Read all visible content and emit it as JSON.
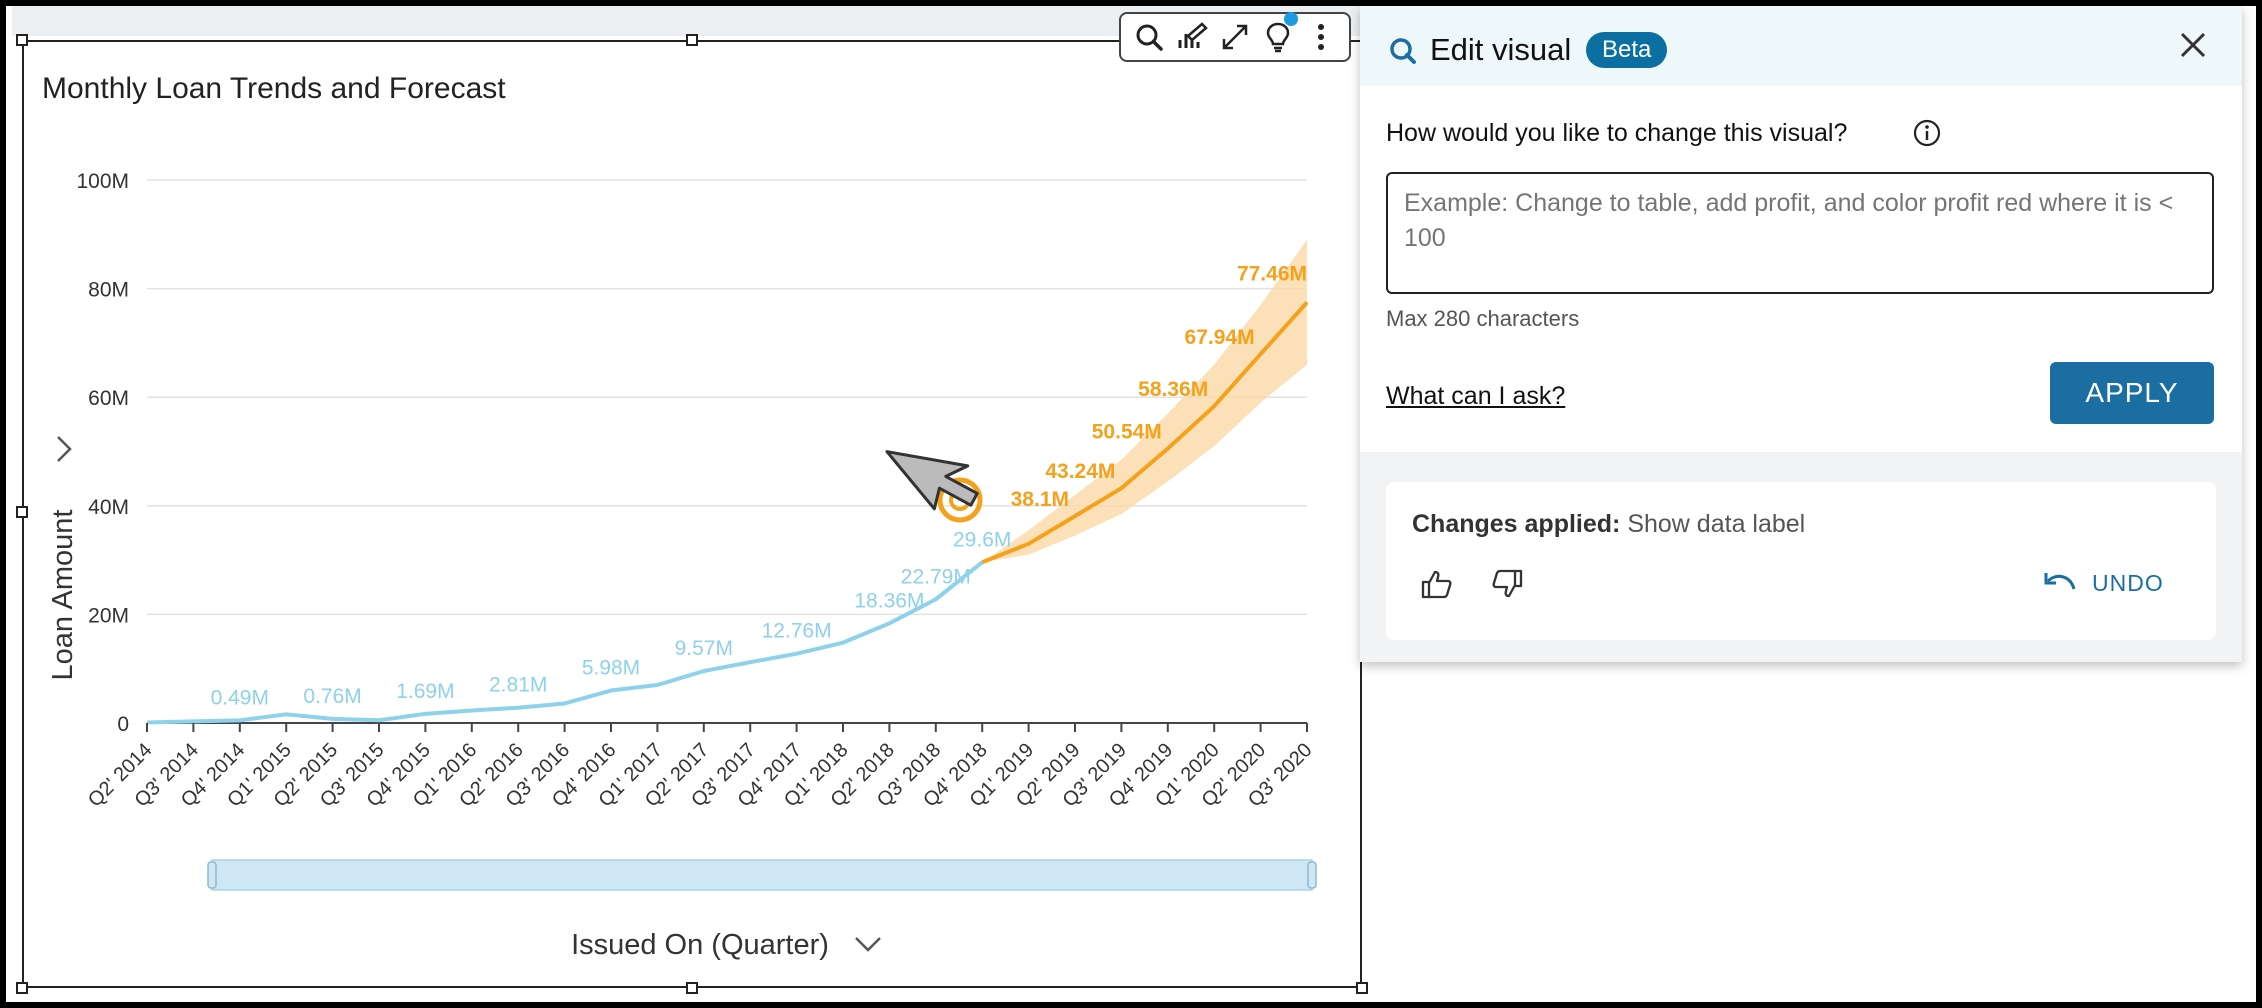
{
  "visual": {
    "title": "Monthly Loan Trends and Forecast"
  },
  "toolbar": {
    "icons": [
      "search-icon",
      "chart-edit-icon",
      "expand-icon",
      "insight-bulb-icon",
      "more-options-icon"
    ]
  },
  "colors": {
    "actual": "#8ed1ea",
    "forecast": "#f5a11c",
    "band": "#fbd9a6",
    "accent": "#1a6ea2",
    "beta_badge": "#0b6fa1"
  },
  "chart_data": {
    "type": "line",
    "title": "Monthly Loan Trends and Forecast",
    "xlabel": "Issued On (Quarter)",
    "ylabel": "Loan Amount",
    "ylim": [
      0,
      100000000
    ],
    "yticks": [
      "100M",
      "80M",
      "60M",
      "40M",
      "20M",
      "0"
    ],
    "grid": true,
    "categories": [
      "Q2' 2014",
      "Q3' 2014",
      "Q4' 2014",
      "Q1' 2015",
      "Q2' 2015",
      "Q3' 2015",
      "Q4' 2015",
      "Q1' 2016",
      "Q2' 2016",
      "Q3' 2016",
      "Q4' 2016",
      "Q1' 2017",
      "Q2' 2017",
      "Q3' 2017",
      "Q4' 2017",
      "Q1' 2018",
      "Q2' 2018",
      "Q3' 2018",
      "Q4' 2018",
      "Q1' 2019",
      "Q2' 2019",
      "Q3' 2019",
      "Q4' 2019",
      "Q1' 2020",
      "Q2' 2020",
      "Q3' 2020"
    ],
    "series": [
      {
        "values": [
          0.1,
          0.3,
          0.49,
          1.6,
          0.76,
          0.5,
          1.69,
          2.3,
          2.81,
          3.6,
          5.98,
          7.0,
          9.57,
          11.2,
          12.76,
          14.8,
          18.36,
          22.79,
          29.6,
          null,
          null,
          null,
          null,
          null,
          null,
          null
        ],
        "labels": [
          "",
          "",
          "0.49M",
          "",
          "0.76M",
          "",
          "1.69M",
          "",
          "2.81M",
          "",
          "5.98M",
          "",
          "9.57M",
          "",
          "12.76M",
          "",
          "18.36M",
          "22.79M",
          "29.6M",
          "",
          "",
          "",
          "",
          "",
          "",
          ""
        ]
      },
      {
        "values": [
          null,
          null,
          null,
          null,
          null,
          null,
          null,
          null,
          null,
          null,
          null,
          null,
          null,
          null,
          null,
          null,
          null,
          null,
          29.6,
          33.0,
          38.1,
          43.24,
          50.54,
          58.36,
          67.94,
          77.46
        ],
        "lower": [
          null,
          null,
          null,
          null,
          null,
          null,
          null,
          null,
          null,
          null,
          null,
          null,
          null,
          null,
          null,
          null,
          null,
          null,
          29.6,
          31.0,
          34.5,
          38.5,
          44.5,
          51.0,
          59.0,
          66.0
        ],
        "upper": [
          null,
          null,
          null,
          null,
          null,
          null,
          null,
          null,
          null,
          null,
          null,
          null,
          null,
          null,
          null,
          null,
          null,
          null,
          29.6,
          35.5,
          42.0,
          48.5,
          57.0,
          66.0,
          77.0,
          89.0
        ],
        "labels": [
          "",
          "",
          "",
          "",
          "",
          "",
          "",
          "",
          "",
          "",
          "",
          "",
          "",
          "",
          "",
          "",
          "",
          "",
          "",
          "",
          "38.1M",
          "43.24M",
          "50.54M",
          "58.36M",
          "67.94M",
          "77.46M"
        ]
      }
    ]
  },
  "panel": {
    "title": "Edit visual",
    "beta_label": "Beta",
    "question_label": "How would you like to change this visual?",
    "input_placeholder": "Example: Change to table, add profit, and color profit red where it is < 100",
    "input_value": "",
    "max_chars": "Max 280 characters",
    "what_can_i_ask": "What can I ask?",
    "apply_label": "APPLY",
    "changes_label": "Changes applied:",
    "changes_value": "Show data label",
    "undo_label": "UNDO"
  }
}
